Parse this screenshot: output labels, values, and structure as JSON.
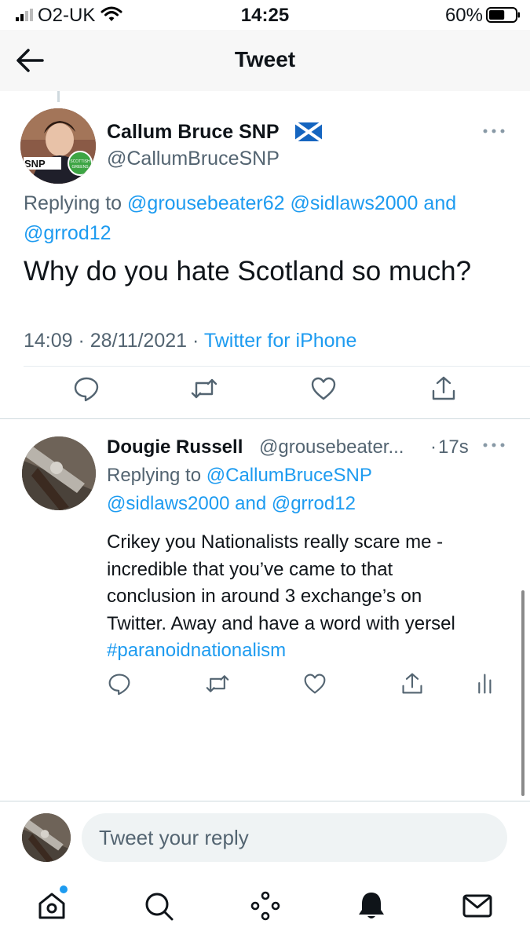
{
  "status_bar": {
    "carrier": "O2-UK",
    "time": "14:25",
    "battery": "60%",
    "battery_level": 0.6
  },
  "nav": {
    "title": "Tweet",
    "back_icon": "arrow-left-icon"
  },
  "main_tweet": {
    "display_name": "Callum Bruce SNP",
    "flag_icon": "scotland-flag-icon",
    "handle": "@CallumBruceSNP",
    "replying_prefix": "Replying to",
    "replying_mentions": [
      "@grousebeater62",
      "@sidlaws2000"
    ],
    "replying_and": "and",
    "replying_last": "@grrod12",
    "text": "Why do you hate Scotland so much?",
    "time": "14:09",
    "date": "28/11/2021",
    "source": "Twitter for iPhone",
    "avatar_badge": {
      "snp": "SNP",
      "greens_line1": "SCOTTISH",
      "greens_line2": "GREENS"
    },
    "actions": [
      "reply-icon",
      "retweet-icon",
      "like-icon",
      "share-icon"
    ]
  },
  "reply_tweet": {
    "display_name": "Dougie Russell",
    "handle": "@grousebeater...",
    "time": "17s",
    "replying_prefix": "Replying to",
    "replying_mention_1": "@CallumBruceSNP",
    "replying_mention_2": "@sidlaws2000",
    "replying_and": "and",
    "replying_last": "@grrod12",
    "text_lines": [
      "Crikey you Nationalists really scare me -",
      "incredible that you’ve came to that",
      "conclusion in around 3 exchange’s on",
      "Twitter. Away and have a word with yersel"
    ],
    "hashtag": "#paranoidnationalism",
    "actions": [
      "reply-icon",
      "retweet-icon",
      "like-icon",
      "share-icon",
      "analytics-icon"
    ]
  },
  "compose": {
    "placeholder": "Tweet your reply"
  },
  "tab_bar": {
    "tabs": [
      "home-icon",
      "search-icon",
      "spaces-icon",
      "notifications-icon",
      "messages-icon"
    ]
  },
  "colors": {
    "accent": "#1d9bf0",
    "text": "#0f1419",
    "secondary": "#536471",
    "header_bg": "#f7f7f7",
    "input_bg": "#eff3f4"
  }
}
